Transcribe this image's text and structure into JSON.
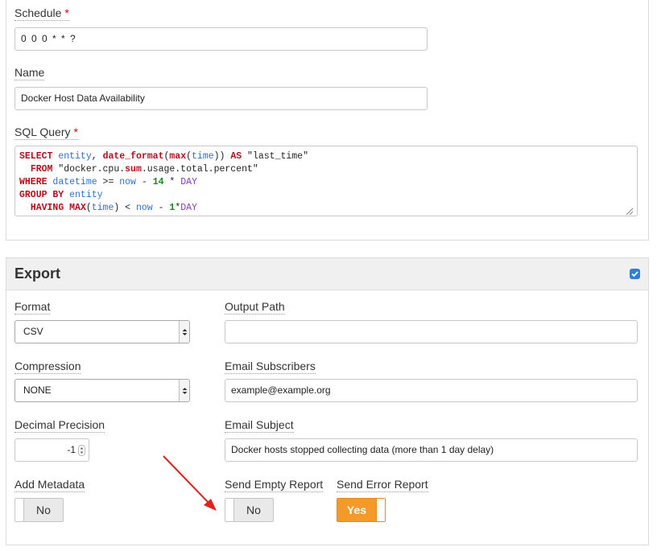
{
  "general": {
    "schedule_label": "Schedule",
    "required_marker": "*",
    "schedule_value": "0 0 0 * * ?",
    "name_label": "Name",
    "name_value": "Docker Host Data Availability",
    "sql_label": "SQL Query"
  },
  "sql": {
    "l1_select": "SELECT",
    "l1_entity": "entity",
    "l1_comma": ", ",
    "l1_datefmt": "date_format",
    "l1_p1": "(",
    "l1_max": "max",
    "l1_p2": "(",
    "l1_time": "time",
    "l1_p3": ")) ",
    "l1_as": "AS",
    "l1_alias": " \"last_time\"",
    "l2_indent": "  ",
    "l2_from": "FROM",
    "l2_metric_a": " \"docker.cpu.",
    "l2_sum": "sum",
    "l2_metric_b": ".usage.total.percent\"",
    "l3_where": "WHERE",
    "l3_datetime": " datetime",
    "l3_op": " >= ",
    "l3_now": "now",
    "l3_minus": " - ",
    "l3_14": "14",
    "l3_times": " * ",
    "l3_day": "DAY",
    "l4_group": "GROUP BY",
    "l4_entity": " entity",
    "l5_indent": "  ",
    "l5_having": "HAVING",
    "l5_max": " MAX",
    "l5_p1": "(",
    "l5_time": "time",
    "l5_p2": ") < ",
    "l5_now": "now",
    "l5_minus": " - ",
    "l5_1": "1",
    "l5_times": "*",
    "l5_day": "DAY"
  },
  "export": {
    "title": "Export",
    "enabled": true,
    "format_label": "Format",
    "format_value": "CSV",
    "output_path_label": "Output Path",
    "output_path_value": "",
    "compression_label": "Compression",
    "compression_value": "NONE",
    "email_subscribers_label": "Email Subscribers",
    "email_subscribers_value": "example@example.org",
    "decimal_precision_label": "Decimal Precision",
    "decimal_precision_value": "-1",
    "email_subject_label": "Email Subject",
    "email_subject_value": "Docker hosts stopped collecting data (more than 1 day delay)",
    "add_metadata_label": "Add Metadata",
    "add_metadata_value": "No",
    "send_empty_label": "Send Empty Report",
    "send_empty_value": "No",
    "send_error_label": "Send Error Report",
    "send_error_value": "Yes"
  },
  "colors": {
    "accent_orange": "#f39a2a",
    "checkbox_blue": "#2f7fd6",
    "required_red": "#d0021b",
    "annotation_arrow": "#e3211c"
  },
  "annotation": {
    "arrow_icon": "red-arrow-pointing-to-send-empty-report"
  }
}
